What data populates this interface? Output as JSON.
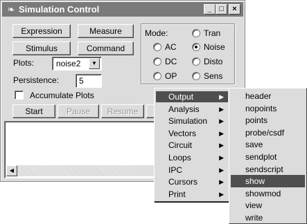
{
  "window": {
    "title": "Simulation Control",
    "controls": [
      "_",
      "□",
      "×"
    ]
  },
  "buttons": {
    "expression": "Expression",
    "measure": "Measure",
    "stimulus": "Stimulus",
    "command": "Command",
    "start": "Start",
    "pause": "Pause",
    "resume": "Resume"
  },
  "plots": {
    "label": "Plots:",
    "value": "noise2"
  },
  "persistence": {
    "label": "Persistence:",
    "value": "5"
  },
  "accumulate": {
    "label": "Accumulate Plots",
    "checked": false
  },
  "mode": {
    "label": "Mode:",
    "options": [
      {
        "label": "Tran",
        "checked": false
      },
      {
        "label": "AC",
        "checked": false
      },
      {
        "label": "Noise",
        "checked": true
      },
      {
        "label": "DC",
        "checked": false
      },
      {
        "label": "Disto",
        "checked": false
      },
      {
        "label": "OP",
        "checked": false
      },
      {
        "label": "Sens",
        "checked": false
      }
    ]
  },
  "context_menu": {
    "items": [
      {
        "label": "Output",
        "selected": true
      },
      {
        "label": "Analysis",
        "selected": false
      },
      {
        "label": "Simulation",
        "selected": false
      },
      {
        "label": "Vectors",
        "selected": false
      },
      {
        "label": "Circuit",
        "selected": false
      },
      {
        "label": "Loops",
        "selected": false
      },
      {
        "label": "IPC",
        "selected": false
      },
      {
        "label": "Cursors",
        "selected": false
      },
      {
        "label": "Print",
        "selected": false
      }
    ],
    "arrow": "▶"
  },
  "submenu": {
    "items": [
      {
        "label": "header",
        "selected": false
      },
      {
        "label": "nopoints",
        "selected": false
      },
      {
        "label": "points",
        "selected": false
      },
      {
        "label": "probe/csdf",
        "selected": false
      },
      {
        "label": "save",
        "selected": false
      },
      {
        "label": "sendplot",
        "selected": false
      },
      {
        "label": "sendscript",
        "selected": false
      },
      {
        "label": "show",
        "selected": true
      },
      {
        "label": "showmod",
        "selected": false
      },
      {
        "label": "view",
        "selected": false
      },
      {
        "label": "write",
        "selected": false
      }
    ]
  },
  "icons": {
    "app": "simulation-app-icon",
    "dropdown": "▼",
    "scroll_left": "◀"
  },
  "colors": {
    "titlebar": "#7a7a7a",
    "selection": "#4f4f4f",
    "face": "#dcdcdc"
  }
}
